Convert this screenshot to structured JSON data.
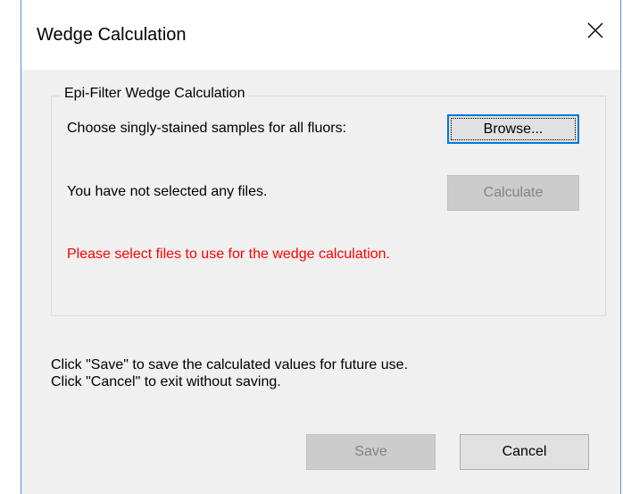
{
  "window": {
    "title": "Wedge Calculation",
    "close_icon": "close-icon"
  },
  "group": {
    "legend": "Epi-Filter Wedge Calculation",
    "choose_label": "Choose singly-stained samples for all fluors:",
    "browse_label": "Browse...",
    "status_label": "You have not selected any files.",
    "calculate_label": "Calculate",
    "error_message": "Please select files to use for the wedge calculation."
  },
  "instructions": {
    "line1": "Click \"Save\" to save the calculated values for future use.",
    "line2": "Click \"Cancel\" to exit without saving."
  },
  "footer": {
    "save_label": "Save",
    "cancel_label": "Cancel"
  },
  "colors": {
    "accent": "#0078d7",
    "error": "#ff0000",
    "window_border": "#5a8fd3"
  }
}
